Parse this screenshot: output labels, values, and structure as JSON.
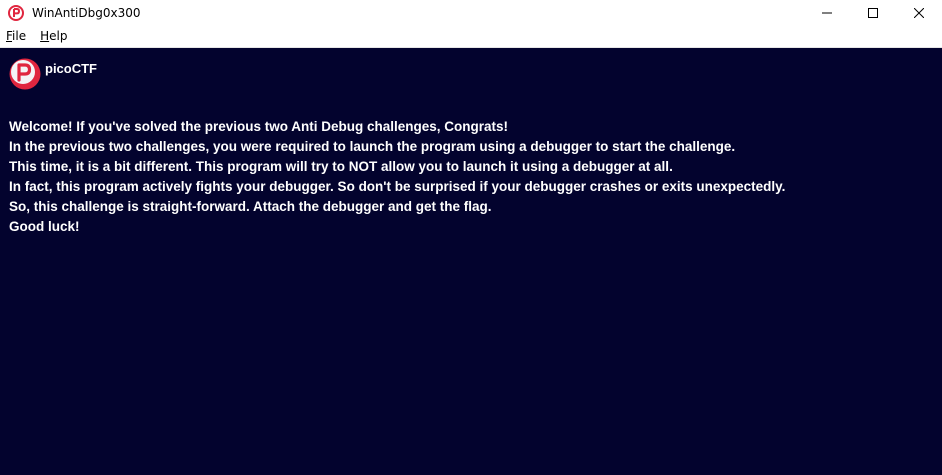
{
  "window": {
    "title": "WinAntiDbg0x300"
  },
  "menu": {
    "file": {
      "accel": "F",
      "rest": "ile"
    },
    "help": {
      "accel": "H",
      "rest": "elp"
    }
  },
  "brand": {
    "name": "picoCTF",
    "logo_letter": "P",
    "accent": "#e0263f"
  },
  "message_lines": [
    "Welcome! If you've solved the previous two Anti Debug challenges, Congrats!",
    "In the previous two challenges, you were required to launch the program using a debugger to start the challenge.",
    "This time, it is a bit different. This program will try to NOT allow you to launch it using a debugger at all.",
    "In fact, this program actively fights your debugger. So don't be surprised if your debugger crashes or exits unexpectedly.",
    "So, this challenge is straight-forward. Attach the debugger and get the flag.",
    "Good luck!"
  ],
  "colors": {
    "background": "#03032e",
    "text": "#ffffff"
  }
}
